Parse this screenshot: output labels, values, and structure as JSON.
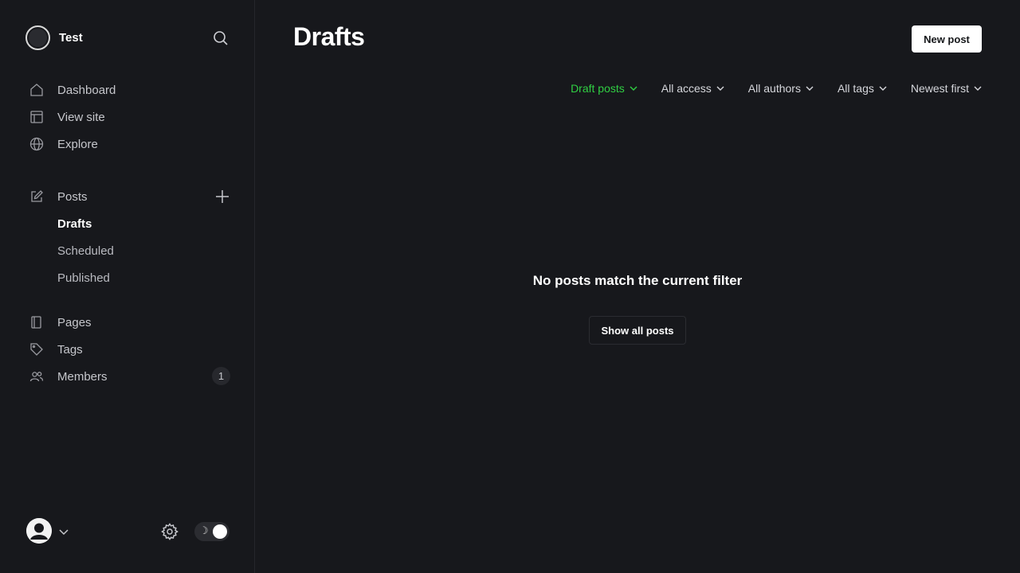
{
  "site": {
    "title": "Test"
  },
  "sidebar": {
    "primary": [
      {
        "label": "Dashboard",
        "icon": "home-icon"
      },
      {
        "label": "View site",
        "icon": "layout-icon"
      },
      {
        "label": "Explore",
        "icon": "globe-icon"
      }
    ],
    "posts": {
      "label": "Posts",
      "icon": "edit-icon",
      "sub": [
        {
          "label": "Drafts",
          "active": true
        },
        {
          "label": "Scheduled",
          "active": false
        },
        {
          "label": "Published",
          "active": false
        }
      ]
    },
    "secondary": [
      {
        "label": "Pages",
        "icon": "page-icon"
      },
      {
        "label": "Tags",
        "icon": "tag-icon"
      },
      {
        "label": "Members",
        "icon": "members-icon",
        "badge": "1"
      }
    ]
  },
  "footer": {
    "theme_icon": "☽"
  },
  "main": {
    "title": "Drafts",
    "new_post_label": "New post",
    "filters": [
      {
        "label": "Draft posts",
        "active": true
      },
      {
        "label": "All access",
        "active": false
      },
      {
        "label": "All authors",
        "active": false
      },
      {
        "label": "All tags",
        "active": false
      },
      {
        "label": "Newest first",
        "active": false
      }
    ],
    "empty_message": "No posts match the current filter",
    "show_all_label": "Show all posts"
  },
  "colors": {
    "background": "#17181c",
    "accent_green": "#30cf43",
    "text_primary": "#ffffff",
    "text_secondary": "#c6c7cc"
  }
}
